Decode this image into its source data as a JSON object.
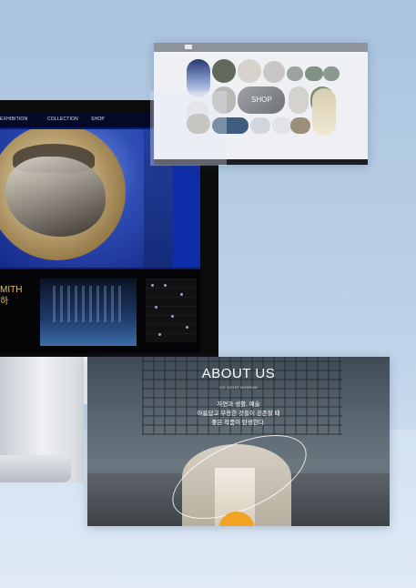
{
  "monitor_site": {
    "nav": [
      "EXHIBITION",
      "COLLECTION",
      "SHOP"
    ],
    "headline_lines": [
      "MITH",
      "하"
    ]
  },
  "shop_site": {
    "shop_label": "SHOP"
  },
  "about_site": {
    "title": "ABOUT US",
    "subtitle": "GO JOOST MUSEUM",
    "body_lines": [
      "자연과 생활, 예술",
      "아름답고 무용한 것들이 공존할 때",
      "좋은 작품이 탄생한다."
    ]
  },
  "colors": {
    "background": "#aac3de",
    "monitor_blue": "#0a1a6d",
    "headline_gold": "#e7c257",
    "accent_orange": "#f1a323"
  }
}
